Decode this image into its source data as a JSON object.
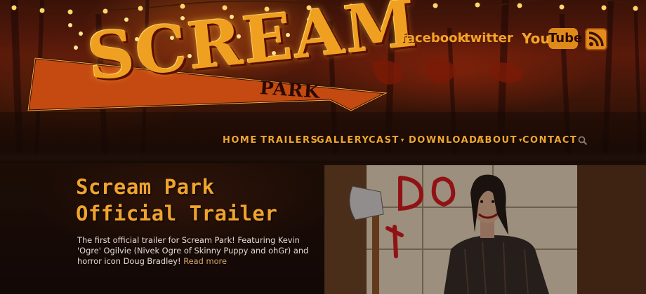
{
  "site": {
    "logo_text": "SCREAM",
    "logo_sub": "PARK"
  },
  "social": {
    "facebook": "facebook",
    "twitter": "twitter",
    "youtube_you": "You",
    "youtube_tube": "Tube",
    "rss_icon": "rss-icon"
  },
  "nav": {
    "items": [
      {
        "label": "HOME"
      },
      {
        "label": "TRAILERS"
      },
      {
        "label": "GALLERY"
      },
      {
        "label": "CAST",
        "caret": "▾"
      },
      {
        "label": "DOWNLOADS"
      },
      {
        "label": "ABOUT",
        "caret": "▾"
      },
      {
        "label": "CONTACT"
      }
    ],
    "search_icon": "search-icon"
  },
  "post": {
    "title": "Scream Park Official Trailer",
    "excerpt": "The first official trailer for Scream Park! Featuring Kevin 'Ogre' Ogilvie (Nivek Ogre of Skinny Puppy and ohGr) and horror icon Doug Bradley!",
    "read_more": "Read more"
  },
  "colors": {
    "accent": "#f0a32d",
    "background": "#120905",
    "header_red": "#5a1a0a"
  }
}
